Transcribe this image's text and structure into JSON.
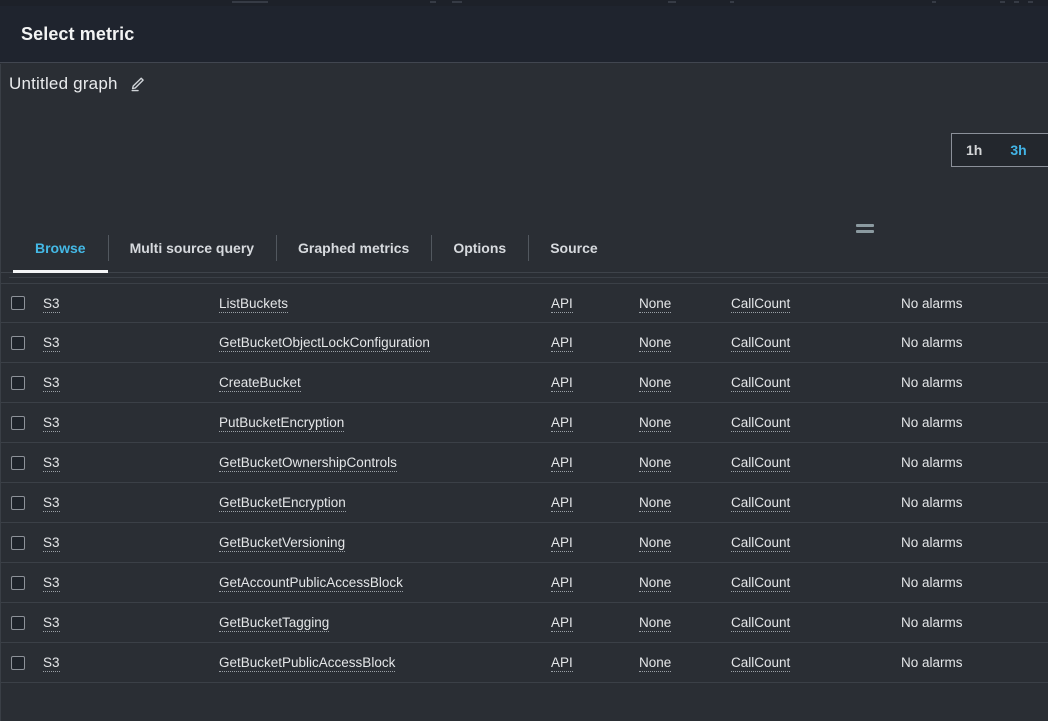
{
  "header": {
    "title": "Select metric"
  },
  "graph": {
    "title": "Untitled graph",
    "edit_icon": "pencil-edit-icon"
  },
  "time_range": {
    "options": [
      {
        "label": "1h",
        "active": false
      },
      {
        "label": "3h",
        "active": true
      }
    ],
    "accent_color": "#42b4e6"
  },
  "resize_handle": {
    "icon": "drag-handle-icon"
  },
  "tabs": [
    {
      "label": "Browse",
      "active": true
    },
    {
      "label": "Multi source query",
      "active": false
    },
    {
      "label": "Graphed metrics",
      "active": false
    },
    {
      "label": "Options",
      "active": false
    },
    {
      "label": "Source",
      "active": false
    }
  ],
  "table": {
    "columns": [
      "select",
      "namespace",
      "metric_name",
      "type",
      "resource",
      "metric",
      "alarms"
    ],
    "rows": [
      {
        "namespace": "S3",
        "metric_name": "ListBuckets",
        "type": "API",
        "resource": "None",
        "metric": "CallCount",
        "alarms": "No alarms"
      },
      {
        "namespace": "S3",
        "metric_name": "GetBucketObjectLockConfiguration",
        "type": "API",
        "resource": "None",
        "metric": "CallCount",
        "alarms": "No alarms"
      },
      {
        "namespace": "S3",
        "metric_name": "CreateBucket",
        "type": "API",
        "resource": "None",
        "metric": "CallCount",
        "alarms": "No alarms"
      },
      {
        "namespace": "S3",
        "metric_name": "PutBucketEncryption",
        "type": "API",
        "resource": "None",
        "metric": "CallCount",
        "alarms": "No alarms"
      },
      {
        "namespace": "S3",
        "metric_name": "GetBucketOwnershipControls",
        "type": "API",
        "resource": "None",
        "metric": "CallCount",
        "alarms": "No alarms"
      },
      {
        "namespace": "S3",
        "metric_name": "GetBucketEncryption",
        "type": "API",
        "resource": "None",
        "metric": "CallCount",
        "alarms": "No alarms"
      },
      {
        "namespace": "S3",
        "metric_name": "GetBucketVersioning",
        "type": "API",
        "resource": "None",
        "metric": "CallCount",
        "alarms": "No alarms"
      },
      {
        "namespace": "S3",
        "metric_name": "GetAccountPublicAccessBlock",
        "type": "API",
        "resource": "None",
        "metric": "CallCount",
        "alarms": "No alarms"
      },
      {
        "namespace": "S3",
        "metric_name": "GetBucketTagging",
        "type": "API",
        "resource": "None",
        "metric": "CallCount",
        "alarms": "No alarms"
      },
      {
        "namespace": "S3",
        "metric_name": "GetBucketPublicAccessBlock",
        "type": "API",
        "resource": "None",
        "metric": "CallCount",
        "alarms": "No alarms"
      }
    ]
  }
}
